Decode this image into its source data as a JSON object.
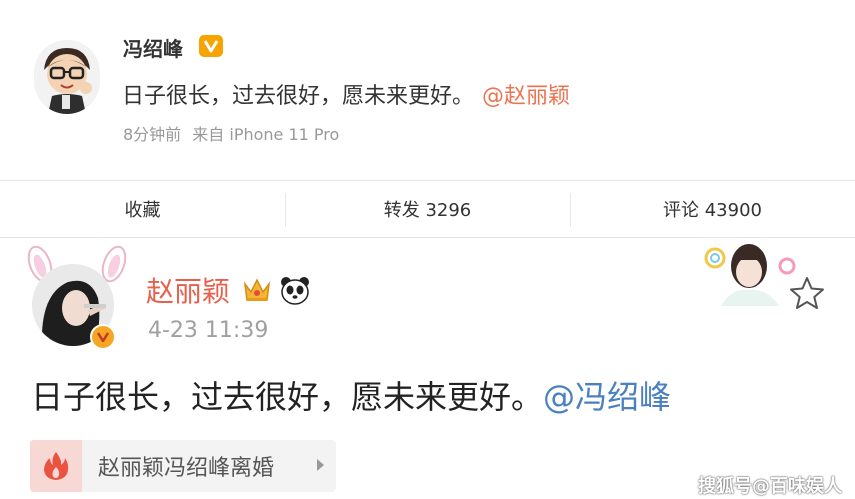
{
  "post1": {
    "author": "冯绍峰",
    "text": "日子很长，过去很好，愿未来更好。",
    "mention": "@赵丽颖",
    "time": "8分钟前",
    "source": "来自 iPhone 11 Pro"
  },
  "actions": {
    "favorite": "收藏",
    "repost": "转发 3296",
    "comment": "评论 43900"
  },
  "post2": {
    "author": "赵丽颖",
    "time": "4-23 11:39",
    "text": "日子很长，过去很好，愿未来更好。",
    "mention": "@冯绍峰",
    "topic": "赵丽颖冯绍峰离婚"
  },
  "watermark": "搜狐号@百味娱人",
  "icons": {
    "verified": "vip-v-icon",
    "crown": "crown-icon",
    "panda": "panda-icon",
    "star": "star-outline-icon",
    "fire": "fire-icon"
  },
  "colors": {
    "name_red": "#e8604d",
    "mention_orange": "#eb7350",
    "mention_blue": "#4a7fc0",
    "badge_gold": "#f7a400"
  }
}
